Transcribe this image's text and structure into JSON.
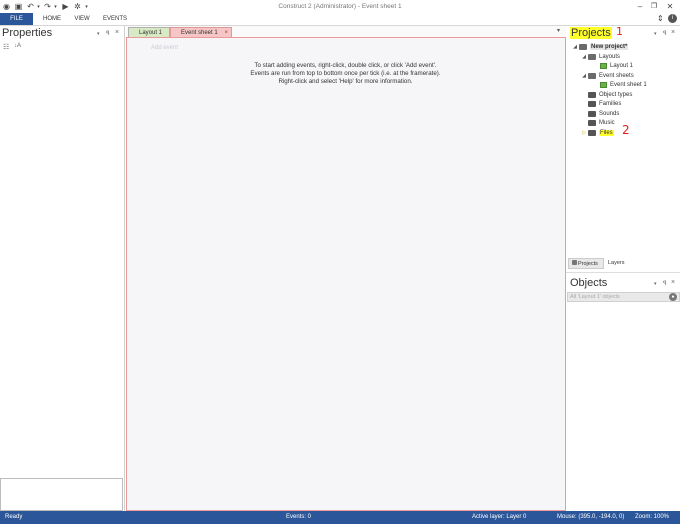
{
  "app": {
    "title": "Construct 2 (Administrator) - Event sheet 1"
  },
  "ribbon": {
    "tabs": [
      "FILE",
      "HOME",
      "VIEW",
      "EVENTS"
    ]
  },
  "properties": {
    "title": "Properties",
    "pin": "ꟼ",
    "close": "×",
    "sort_category": "☷",
    "sort_alpha": "↓A"
  },
  "doc_tabs": {
    "layout": "Layout 1",
    "event": "Event sheet 1",
    "close": "×",
    "dropdown": "▾"
  },
  "event_sheet": {
    "placeholder": "Add event",
    "messages": [
      "To start adding events, right-click, double click, or click 'Add event'.",
      "Events are run from top to bottom once per tick (i.e. at the framerate).",
      "Right-click and select 'Help' for more information."
    ]
  },
  "projects": {
    "title": "Projects",
    "annotation_1": "1",
    "annotation_2": "2",
    "root": "New project*",
    "items": {
      "layouts": "Layouts",
      "layout1": "Layout 1",
      "eventsheets": "Event sheets",
      "eventsheet1": "Event sheet 1",
      "objecttypes": "Object types",
      "families": "Families",
      "sounds": "Sounds",
      "music": "Music",
      "files": "Files"
    }
  },
  "bottom_tabs": [
    "Projects",
    "Layers"
  ],
  "objects": {
    "title": "Objects",
    "filter_placeholder": "All 'Layout 1' objects"
  },
  "status": {
    "ready": "Ready",
    "events": "Events: 0",
    "active_layer": "Active layer: Layer 0",
    "mouse": "Mouse: (395.0, -194.0, 0)",
    "zoom": "Zoom: 100%"
  },
  "colors": {
    "accent": "#2b579a",
    "highlight": "#ffff2a",
    "annotation": "#e02020",
    "layout_tab": "#d8eac3",
    "event_tab": "#f6c6c6"
  }
}
